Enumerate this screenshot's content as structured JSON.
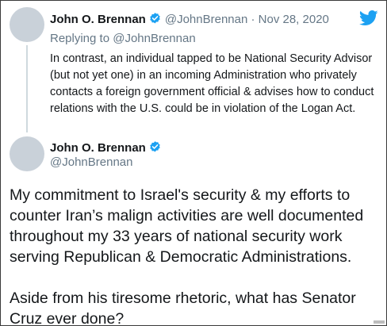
{
  "reply_tweet": {
    "author_name": "John O. Brennan",
    "handle": "@JohnBrennan",
    "separator": "·",
    "date": "Nov 28, 2020",
    "replying_to": "Replying to @JohnBrennan",
    "text": "In contrast, an individual tapped to be National Security Advisor (but not yet one) in an incoming Administration who privately contacts a foreign government official & advises how to conduct relations with the U.S. could be in violation of the Logan Act."
  },
  "main_tweet": {
    "author_name": "John O. Brennan",
    "handle": "@JohnBrennan",
    "paragraph1": "My commitment to Israel's security & my efforts to counter Iran’s malign activities are well documented throughout my 33 years of national security work serving Republican & Democratic Administrations.",
    "paragraph2": "Aside from his tiresome rhetoric, what has Senator Cruz ever done?"
  },
  "icons": {
    "verified": "verified-badge-icon",
    "logo": "twitter-bird-icon"
  },
  "colors": {
    "verified_blue": "#1da1f2",
    "muted_text": "#657786",
    "primary_text": "#14171a",
    "avatar_placeholder": "#c9d1d9",
    "thread_line": "#cfd9de"
  }
}
